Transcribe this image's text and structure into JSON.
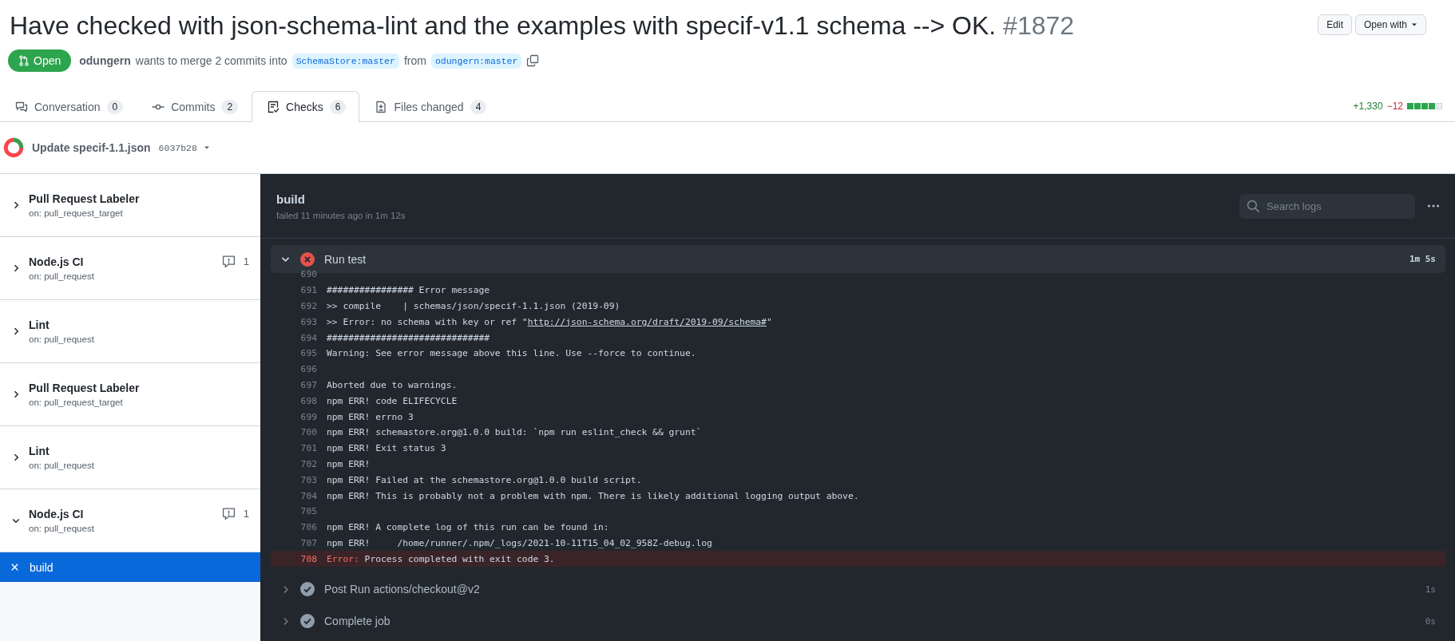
{
  "pull_request": {
    "title": "Have checked with json-schema-lint and the examples with specif-v1.1 schema --> OK.",
    "number": "#1872",
    "state": "Open",
    "author": "odungern",
    "merge_text": "wants to merge 2 commits into",
    "base_branch": "SchemaStore:master",
    "from_text": "from",
    "head_branch": "odungern:master"
  },
  "header_buttons": [
    {
      "label": "Edit",
      "dropdown": false
    },
    {
      "label": "Open with",
      "dropdown": true
    }
  ],
  "tabs": [
    {
      "kind": "conversation",
      "label": "Conversation",
      "count": "0",
      "selected": false
    },
    {
      "kind": "commits",
      "label": "Commits",
      "count": "2",
      "selected": false
    },
    {
      "kind": "checks",
      "label": "Checks",
      "count": "6",
      "selected": true
    },
    {
      "kind": "files",
      "label": "Files changed",
      "count": "4",
      "selected": false
    }
  ],
  "diffstat": {
    "additions": "+1,330",
    "deletions": "−12",
    "blocks": [
      {
        "kind": "added"
      },
      {
        "kind": "added"
      },
      {
        "kind": "added"
      },
      {
        "kind": "added"
      },
      {
        "kind": "neutral"
      }
    ]
  },
  "commit": {
    "message": "Update specif-1.1.json",
    "sha": "6037b28"
  },
  "workflows": [
    {
      "name": "Pull Request Labeler",
      "trigger": "on: pull_request_target",
      "expanded": false
    },
    {
      "name": "Node.js CI",
      "trigger": "on: pull_request",
      "expanded": false,
      "annotations": "1"
    },
    {
      "name": "Lint",
      "trigger": "on: pull_request",
      "expanded": false
    },
    {
      "name": "Pull Request Labeler",
      "trigger": "on: pull_request_target",
      "expanded": false
    },
    {
      "name": "Lint",
      "trigger": "on: pull_request",
      "expanded": false
    },
    {
      "name": "Node.js CI",
      "trigger": "on: pull_request",
      "expanded": true,
      "annotations": "1",
      "children": [
        {
          "name": "build",
          "failed": true,
          "selected": true
        }
      ]
    }
  ],
  "job": {
    "name": "build",
    "summary": "failed 11 minutes ago in 1m 12s",
    "search": {
      "placeholder": "Search logs"
    },
    "steps": [
      {
        "name": "Run test",
        "failed": true,
        "duration": "1m 5s",
        "expanded": true,
        "log": [
          {
            "number": "690",
            "kind": "plain"
          },
          {
            "number": "691",
            "kind": "plain",
            "text": "################ Error message"
          },
          {
            "number": "692",
            "kind": "plain",
            "text": ">> compile    | schemas/json/specif-1.1.json (2019-09)"
          },
          {
            "number": "693",
            "kind": "plain",
            "text": ">> Error: no schema with key or ref \"",
            "link": "http://json-schema.org/draft/2019-09/schema#",
            "after": "\""
          },
          {
            "number": "694",
            "kind": "plain",
            "text": "##############################"
          },
          {
            "number": "695",
            "kind": "plain",
            "text": "Warning: See error message above this line. Use --force to continue."
          },
          {
            "number": "696",
            "kind": "plain"
          },
          {
            "number": "697",
            "kind": "plain",
            "text": "Aborted due to warnings."
          },
          {
            "number": "698",
            "kind": "plain",
            "text": "npm ERR! code ELIFECYCLE"
          },
          {
            "number": "699",
            "kind": "plain",
            "text": "npm ERR! errno 3"
          },
          {
            "number": "700",
            "kind": "plain",
            "text": "npm ERR! schemastore.org@1.0.0 build: `npm run eslint_check && grunt`"
          },
          {
            "number": "701",
            "kind": "plain",
            "text": "npm ERR! Exit status 3"
          },
          {
            "number": "702",
            "kind": "plain",
            "text": "npm ERR!"
          },
          {
            "number": "703",
            "kind": "plain",
            "text": "npm ERR! Failed at the schemastore.org@1.0.0 build script."
          },
          {
            "number": "704",
            "kind": "plain",
            "text": "npm ERR! This is probably not a problem with npm. There is likely additional logging output above."
          },
          {
            "number": "705",
            "kind": "plain"
          },
          {
            "number": "706",
            "kind": "plain",
            "text": "npm ERR! A complete log of this run can be found in:"
          },
          {
            "number": "707",
            "kind": "plain",
            "text": "npm ERR!     /home/runner/.npm/_logs/2021-10-11T15_04_02_958Z-debug.log"
          },
          {
            "number": "708",
            "kind": "error",
            "label": "Error:",
            "text": " Process completed with exit code 3."
          }
        ]
      },
      {
        "name": "Post Run actions/checkout@v2",
        "failed": false,
        "duration": "1s",
        "expanded": false
      },
      {
        "name": "Complete job",
        "failed": false,
        "duration": "0s",
        "expanded": false
      }
    ]
  }
}
